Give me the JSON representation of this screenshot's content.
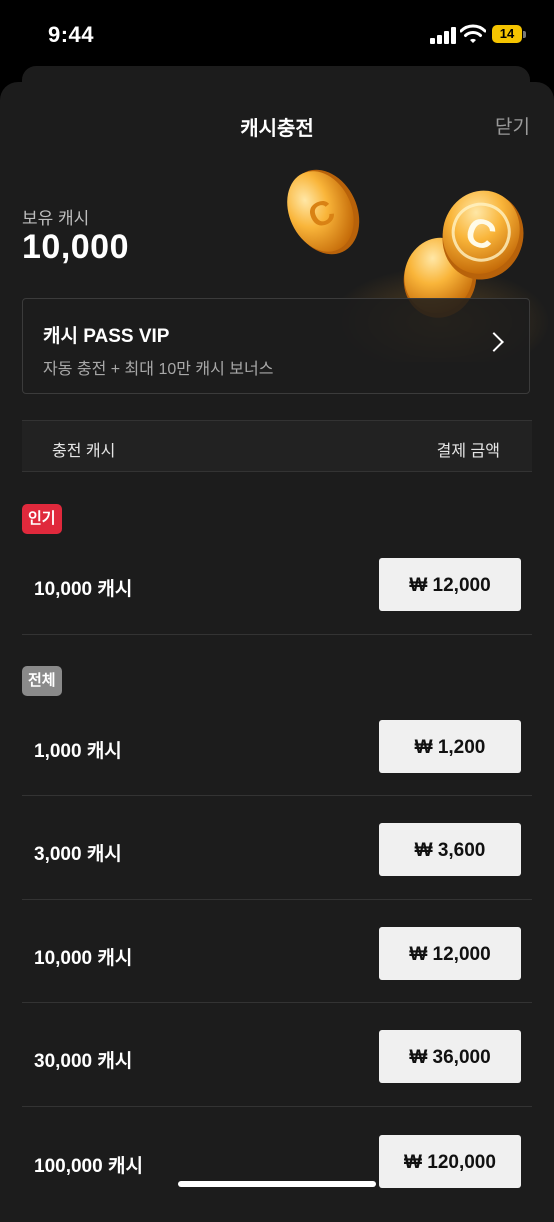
{
  "status_bar": {
    "time": "9:44",
    "battery": "14"
  },
  "header": {
    "title": "캐시충전",
    "close_label": "닫기"
  },
  "balance": {
    "label": "보유 캐시",
    "value": "10,000"
  },
  "pass": {
    "title": "캐시 PASS VIP",
    "subtitle": "자동 충전 + 최대 10만 캐시 보너스"
  },
  "table": {
    "left_header": "충전 캐시",
    "right_header": "결제 금액"
  },
  "popular": {
    "tag": "인기",
    "items": [
      {
        "label": "10,000 캐시",
        "price": "₩ 12,000"
      }
    ]
  },
  "all": {
    "tag": "전체",
    "items": [
      {
        "label": "1,000 캐시",
        "price": "₩ 1,200"
      },
      {
        "label": "3,000 캐시",
        "price": "₩ 3,600"
      },
      {
        "label": "10,000 캐시",
        "price": "₩ 12,000"
      },
      {
        "label": "30,000 캐시",
        "price": "₩ 36,000"
      },
      {
        "label": "100,000 캐시",
        "price": "₩ 120,000"
      }
    ]
  },
  "colors": {
    "popular_tag": "#e0293c",
    "all_tag": "#8a8a8a",
    "sheet_bg": "#1c1c1c",
    "price_button_bg": "#f0f0f0"
  },
  "icons": [
    "signal-icon",
    "wifi-icon",
    "battery-icon",
    "coin-icon",
    "chevron-right-icon"
  ]
}
